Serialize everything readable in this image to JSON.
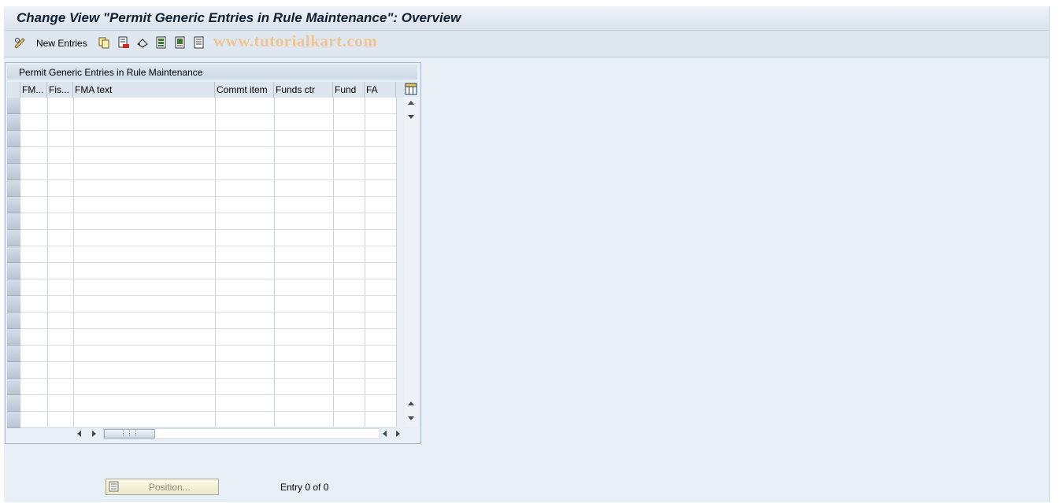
{
  "window": {
    "title": "Change View \"Permit Generic Entries in Rule Maintenance\": Overview"
  },
  "toolbar": {
    "new_entries_label": "New Entries",
    "icons": [
      "edit-glasses-icon",
      "copy-icon",
      "delete-icon",
      "undo-icon",
      "select-all-icon",
      "select-block-icon",
      "deselect-all-icon"
    ],
    "watermark": "www.tutorialkart.com"
  },
  "table": {
    "caption": "Permit Generic Entries in Rule Maintenance",
    "columns": [
      "FM...",
      "Fis...",
      "FMA text",
      "Commt item",
      "Funds ctr",
      "Fund",
      "FA"
    ],
    "rows": []
  },
  "footer": {
    "position_button_label": "Position...",
    "entry_status": "Entry 0 of 0"
  },
  "colors": {
    "background": "#e9eff6",
    "title_text": "#10202f",
    "watermark": "#f0c48e",
    "position_button": "#ece8c8"
  }
}
